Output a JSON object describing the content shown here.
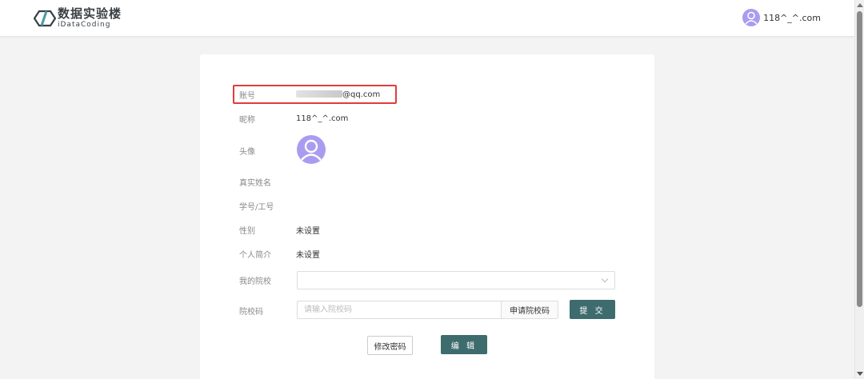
{
  "header": {
    "logo_cn": "数据实验楼",
    "logo_en": "iDataCoding",
    "username": "118^_^.com"
  },
  "profile": {
    "account_label": "账号",
    "account_value_suffix": "@qq.com",
    "nickname_label": "昵称",
    "nickname_value": "118^_^.com",
    "avatar_label": "头像",
    "realname_label": "真实姓名",
    "realname_value": "",
    "student_id_label": "学号/工号",
    "student_id_value": "",
    "gender_label": "性别",
    "gender_value": "未设置",
    "bio_label": "个人简介",
    "bio_value": "未设置",
    "school_label": "我的院校",
    "school_value": "",
    "school_code_label": "院校码",
    "school_code_placeholder": "请输入院校码",
    "apply_code_label": "申请院校码",
    "submit_label": "提 交"
  },
  "actions": {
    "change_password_label": "修改密码",
    "edit_label": "编 辑"
  },
  "colors": {
    "accent": "#3e6b6e",
    "avatar": "#a99cf0",
    "highlight": "#e03c3c"
  },
  "icons": {
    "logo": "logo-icon",
    "user_avatar": "user-avatar-icon",
    "select_chevron": "chevron-down-icon"
  }
}
